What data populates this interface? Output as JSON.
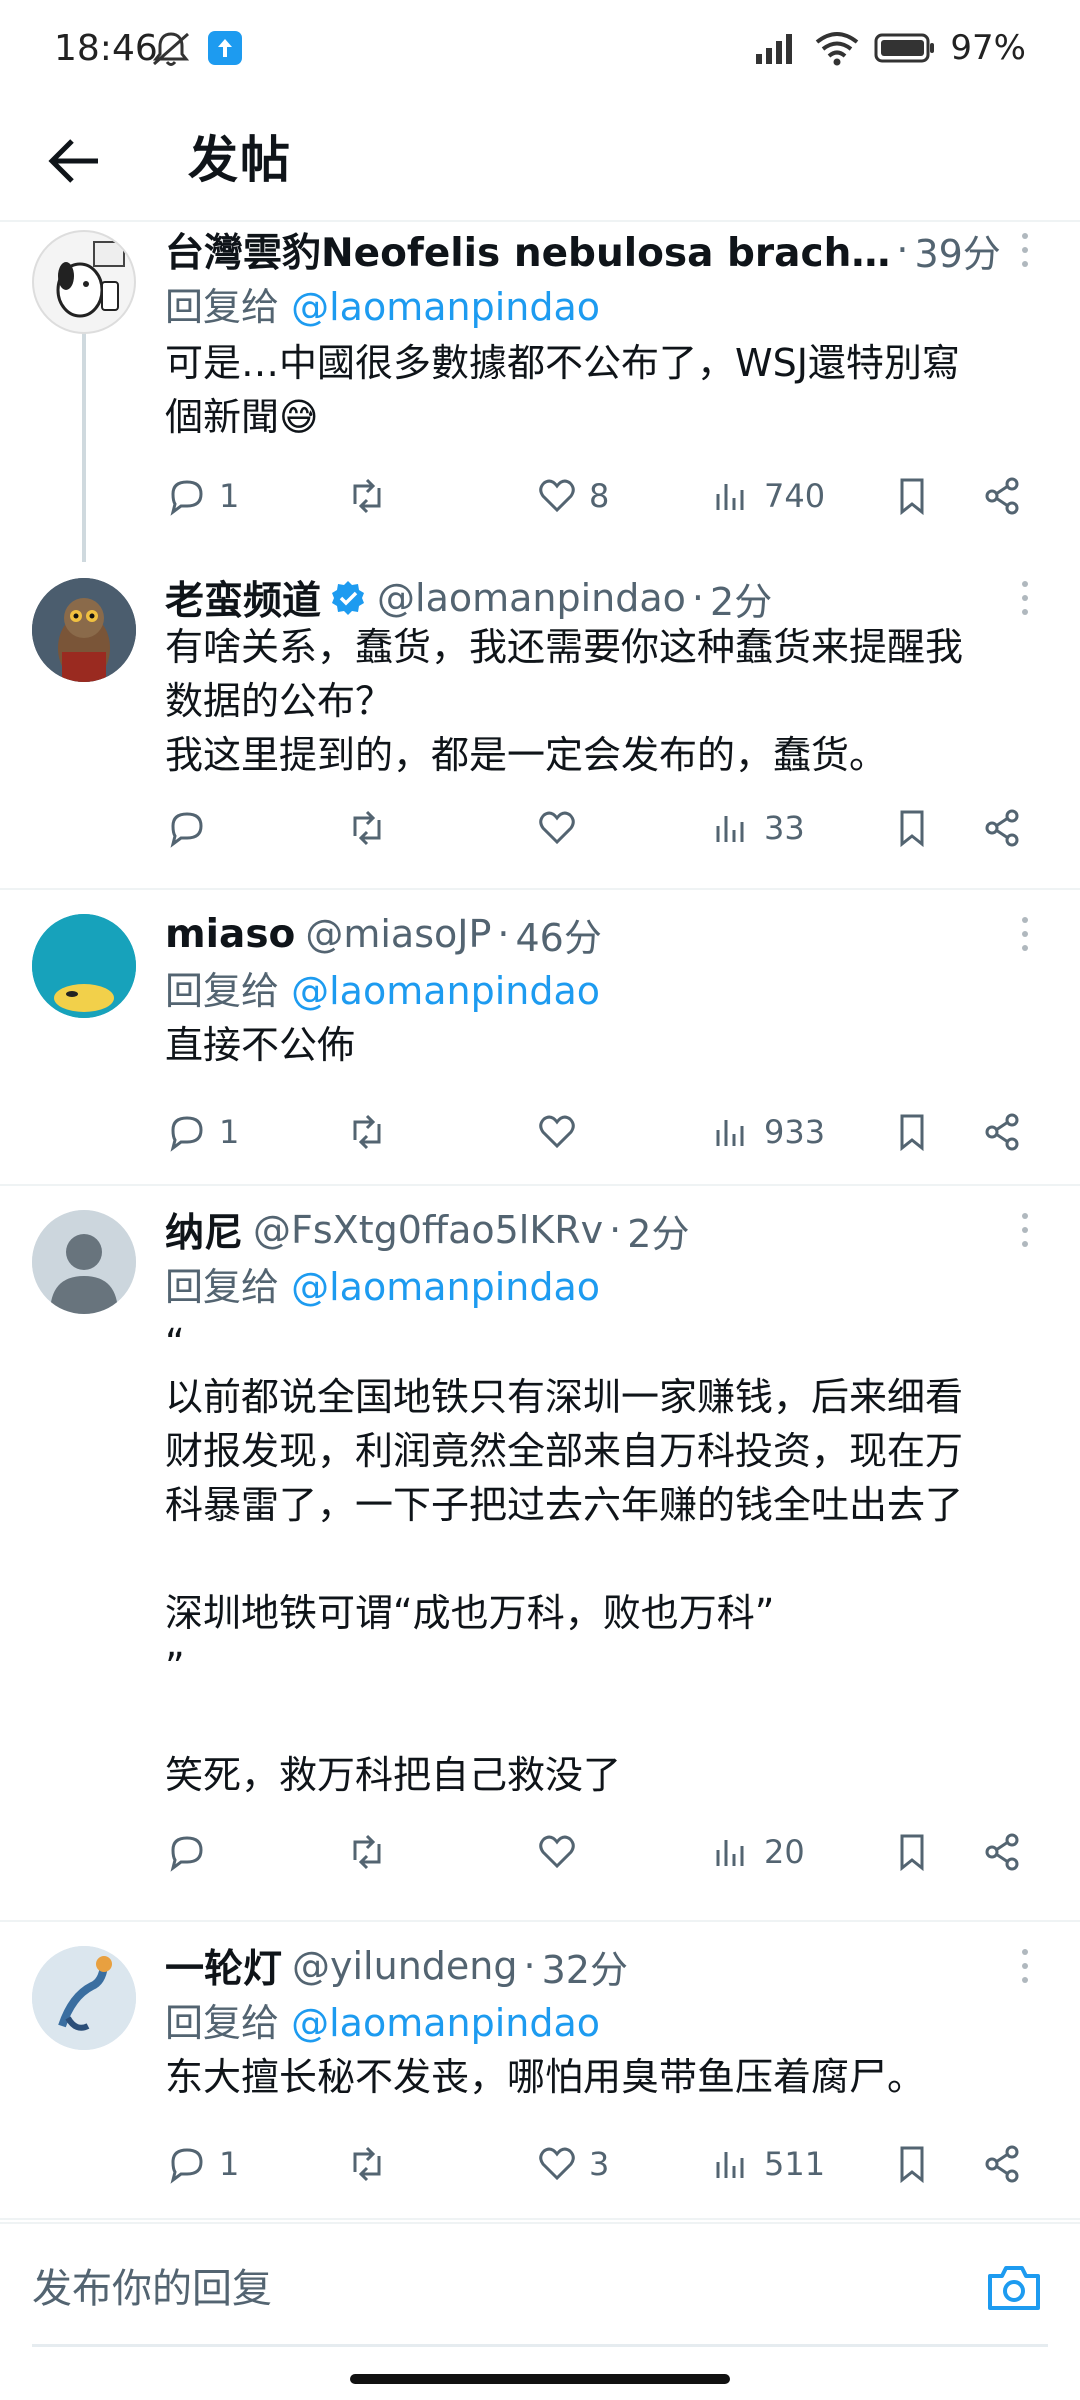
{
  "status_bar": {
    "time": "18:46",
    "battery": "97%"
  },
  "header": {
    "title": "发帖"
  },
  "tweets": [
    {
      "name": "台灣雲豹Neofelis nebulosa brach…",
      "handle": "",
      "time": "39分",
      "reply_to_prefix": "回复给",
      "reply_to_handle": "@laomanpindao",
      "text": "可是…中國很多數據都不公布了，WSJ還特別寫\n個新聞😅",
      "replies": "1",
      "retweets": "",
      "likes": "8",
      "views": "740"
    },
    {
      "name": "老蛮频道",
      "verified": true,
      "handle": "@laomanpindao",
      "time": "2分",
      "text": "有啥关系，蠢货，我还需要你这种蠢货来提醒我\n数据的公布？\n我这里提到的，都是一定会发布的，蠢货。",
      "replies": "",
      "retweets": "",
      "likes": "",
      "views": "33"
    },
    {
      "name": "miaso",
      "handle": "@miasoJP",
      "time": "46分",
      "reply_to_prefix": "回复给",
      "reply_to_handle": "@laomanpindao",
      "text": "直接不公佈",
      "replies": "1",
      "retweets": "",
      "likes": "",
      "views": "933"
    },
    {
      "name": "纳尼",
      "handle": "@FsXtg0ffao5lKRv",
      "time": "2分",
      "reply_to_prefix": "回复给",
      "reply_to_handle": "@laomanpindao",
      "text": "“\n以前都说全国地铁只有深圳一家赚钱，后来细看\n财报发现，利润竟然全部来自万科投资，现在万\n科暴雷了，一下子把过去六年赚的钱全吐出去了\n\n深圳地铁可谓“成也万科，败也万科”\n”\n\n笑死，救万科把自己救没了",
      "replies": "",
      "retweets": "",
      "likes": "",
      "views": "20"
    },
    {
      "name": "一轮灯",
      "handle": "@yilundeng",
      "time": "32分",
      "reply_to_prefix": "回复给",
      "reply_to_handle": "@laomanpindao",
      "text": "东大擅长秘不发丧，哪怕用臭带鱼压着腐尸。",
      "replies": "1",
      "retweets": "",
      "likes": "3",
      "views": "511"
    }
  ],
  "composer": {
    "placeholder": "发布你的回复"
  },
  "colors": {
    "accent": "#1d9bf0",
    "text": "#0f1419",
    "secondary": "#536471",
    "divider": "#eff3f4"
  }
}
